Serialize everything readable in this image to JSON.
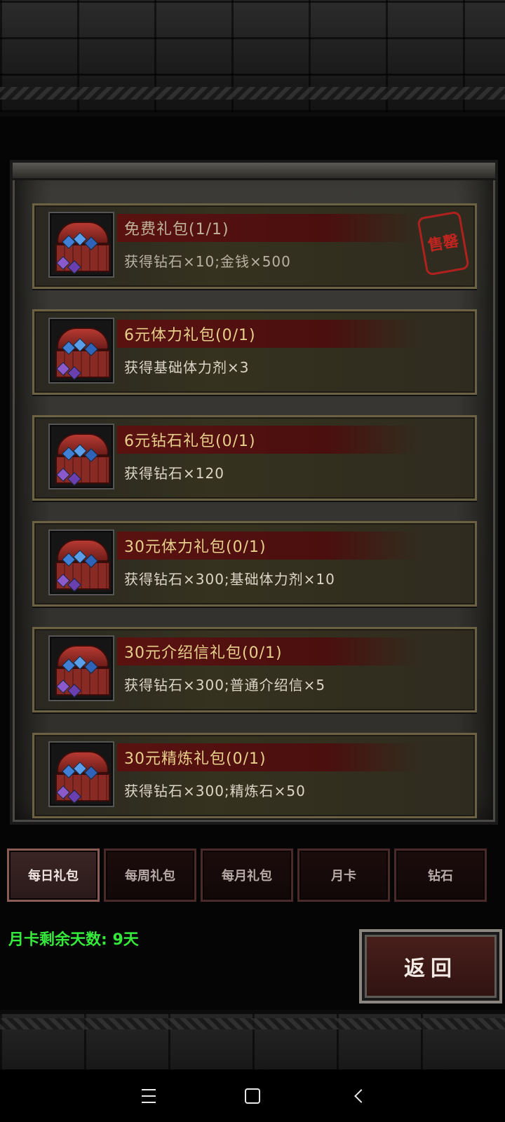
{
  "packages": [
    {
      "title": "免费礼包(1/1)",
      "desc": "获得钻石×10;金钱×500",
      "sold_out": true,
      "stamp": "售罄"
    },
    {
      "title": "6元体力礼包(0/1)",
      "desc": "获得基础体力剂×3",
      "sold_out": false
    },
    {
      "title": "6元钻石礼包(0/1)",
      "desc": "获得钻石×120",
      "sold_out": false
    },
    {
      "title": "30元体力礼包(0/1)",
      "desc": "获得钻石×300;基础体力剂×10",
      "sold_out": false
    },
    {
      "title": "30元介绍信礼包(0/1)",
      "desc": "获得钻石×300;普通介绍信×5",
      "sold_out": false
    },
    {
      "title": "30元精炼礼包(0/1)",
      "desc": "获得钻石×300;精炼石×50",
      "sold_out": false
    }
  ],
  "tabs": [
    {
      "label": "每日礼包",
      "active": true
    },
    {
      "label": "每周礼包",
      "active": false
    },
    {
      "label": "每月礼包",
      "active": false
    },
    {
      "label": "月卡",
      "active": false
    },
    {
      "label": "钻石",
      "active": false
    }
  ],
  "month_card_info": "月卡剩余天数: 9天",
  "back_label": "返回",
  "icons": [
    "gem-chest-icon",
    "menu-icon",
    "home-icon",
    "back-icon"
  ],
  "colors": {
    "title_gold": "#e7cf8c",
    "info_green": "#36ea3c",
    "stamp_red": "#c2241f"
  }
}
